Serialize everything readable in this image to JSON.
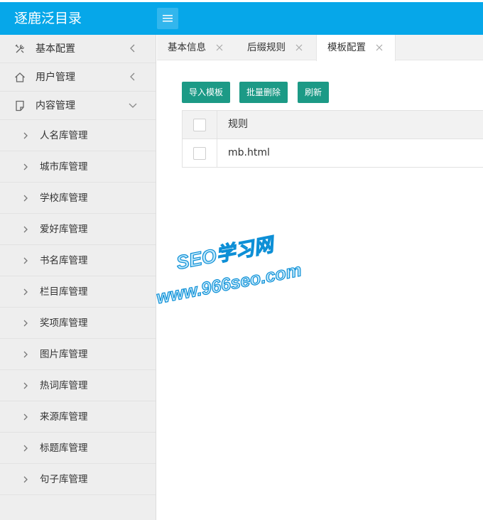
{
  "app": {
    "title": "逐鹿泛目录"
  },
  "sidebar": {
    "items": [
      {
        "label": "基本配置",
        "icon": "tools-icon",
        "expanded": false
      },
      {
        "label": "用户管理",
        "icon": "home-icon",
        "expanded": false
      },
      {
        "label": "内容管理",
        "icon": "document-icon",
        "expanded": true
      }
    ],
    "subitems": [
      "人名库管理",
      "城市库管理",
      "学校库管理",
      "爱好库管理",
      "书名库管理",
      "栏目库管理",
      "奖项库管理",
      "图片库管理",
      "热词库管理",
      "来源库管理",
      "标题库管理",
      "句子库管理"
    ]
  },
  "tabs": [
    {
      "label": "基本信息",
      "active": false
    },
    {
      "label": "后缀规则",
      "active": false
    },
    {
      "label": "模板配置",
      "active": true
    }
  ],
  "toolbar": {
    "import_label": "导入模板",
    "batch_delete_label": "批量删除",
    "refresh_label": "刷新"
  },
  "table": {
    "columns": [
      "规则"
    ],
    "rows": [
      {
        "rule": "mb.html",
        "checked": false
      }
    ]
  },
  "watermark": {
    "line1": "SEO学习网",
    "line2": "www.966seo.com"
  },
  "colors": {
    "topbar": "#06a7e9",
    "button": "#1c9a86",
    "sidebar_bg": "#eeeeee",
    "watermark_fill": "#bfe8fb",
    "watermark_stroke": "#0d8fd6"
  }
}
